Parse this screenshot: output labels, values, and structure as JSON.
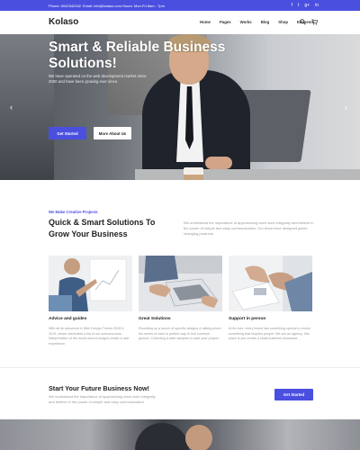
{
  "topbar": {
    "phone": "Phone: 0042342342",
    "email": "Email: info@kolaso.com",
    "hours": "Hours: Mon-Fri 8am - 7pm",
    "social": [
      "f",
      "t",
      "g+",
      "in"
    ]
  },
  "header": {
    "logo": "Kolaso",
    "nav": [
      "Home",
      "Pages",
      "Works",
      "Blog",
      "Shop",
      "Elements"
    ],
    "icons": [
      "search-icon",
      "cart-icon"
    ]
  },
  "hero": {
    "title": "Smart & Reliable Business Solutions!",
    "subtitle": "We have operated on the web development market since 2000 and have been growing ever since.",
    "primary_button": "Get Started",
    "secondary_button": "More About Us",
    "slide_count": 3,
    "active_slide": 0
  },
  "intro": {
    "eyebrow": "We Make Creative Projects",
    "title": "Quick & Smart Solutions To Grow Your Business",
    "text": "We understand the importance of approaching each work integrally and believe in the power of simple and easy communication. Our team have designed game-changing products."
  },
  "cards": [
    {
      "title": "Advice and guides",
      "text": "With all its advanced in Web Design Trends 2018 & 2019, newer dominates a list of our subconscious. Interpretation of the world around images create a user experience."
    },
    {
      "title": "Great Solutions",
      "text": "Rounding up a bunch of specific designs & talking about the merits of each is perfect way to find common ground. Collecting a wide samples to start your project."
    },
    {
      "title": "Support in person",
      "text": "At its core, every brand has something special to reveal something that inspires people. We are an agency, this place is you create a small business showcase."
    }
  ],
  "cta": {
    "title": "Start Your Future Business Now!",
    "text": "We understand the importance of approaching each work integrally and believe in the power of simple and easy communication.",
    "button": "Get Started"
  },
  "colors": {
    "accent": "#4b4fe0",
    "text_dark": "#222222",
    "text_muted": "#999999"
  }
}
